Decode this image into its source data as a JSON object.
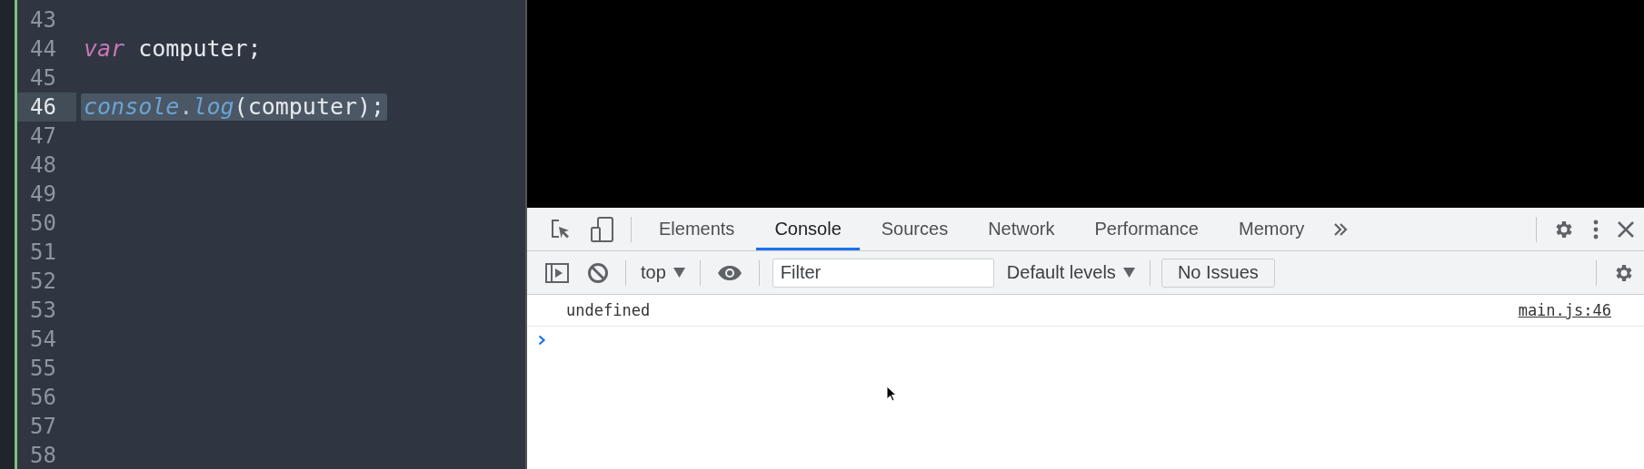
{
  "editor": {
    "lines": [
      {
        "number": "43",
        "selected": false
      },
      {
        "number": "44",
        "selected": false,
        "tokens": [
          {
            "kind": "keyword",
            "text": "var"
          },
          {
            "kind": "plain",
            "text": " computer;"
          }
        ]
      },
      {
        "number": "45",
        "selected": false
      },
      {
        "number": "46",
        "selected": true,
        "tokens": [
          {
            "kind": "object",
            "text": "console"
          },
          {
            "kind": "punct",
            "text": "."
          },
          {
            "kind": "object",
            "text": "log"
          },
          {
            "kind": "plain",
            "text": "(computer);"
          }
        ]
      },
      {
        "number": "47",
        "selected": false
      },
      {
        "number": "48",
        "selected": false
      },
      {
        "number": "49",
        "selected": false
      },
      {
        "number": "50",
        "selected": false
      },
      {
        "number": "51",
        "selected": false
      },
      {
        "number": "52",
        "selected": false
      },
      {
        "number": "53",
        "selected": false
      },
      {
        "number": "54",
        "selected": false
      },
      {
        "number": "55",
        "selected": false
      },
      {
        "number": "56",
        "selected": false
      },
      {
        "number": "57",
        "selected": false
      },
      {
        "number": "58",
        "selected": false
      }
    ]
  },
  "devtools": {
    "tabs": [
      {
        "label": "Elements",
        "selected": false
      },
      {
        "label": "Console",
        "selected": true
      },
      {
        "label": "Sources",
        "selected": false
      },
      {
        "label": "Network",
        "selected": false
      },
      {
        "label": "Performance",
        "selected": false
      },
      {
        "label": "Memory",
        "selected": false
      }
    ],
    "context": "top",
    "filter": {
      "placeholder": "Filter"
    },
    "levels": "Default levels",
    "issues": "No Issues",
    "messages": [
      {
        "text": "undefined",
        "source": "main.js:46"
      }
    ]
  }
}
